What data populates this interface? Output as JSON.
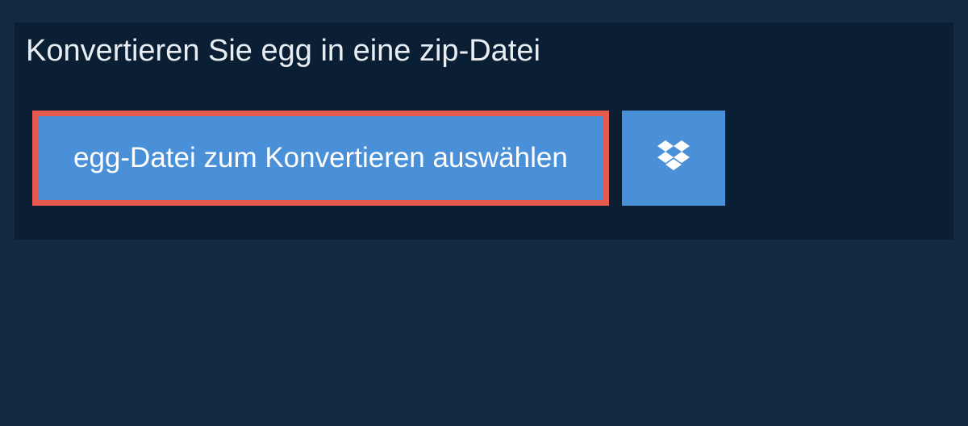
{
  "title": "Konvertieren Sie egg in eine zip-Datei",
  "choose_file_label": "egg-Datei zum Konvertieren auswählen"
}
